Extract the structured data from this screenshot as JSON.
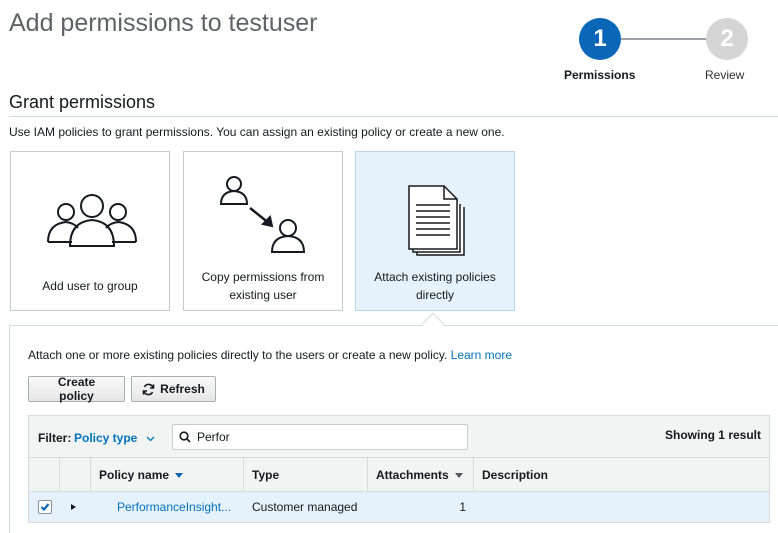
{
  "page": {
    "title": "Add permissions to testuser"
  },
  "stepper": {
    "steps": [
      {
        "number": "1",
        "label": "Permissions"
      },
      {
        "number": "2",
        "label": "Review"
      }
    ]
  },
  "grant": {
    "title": "Grant permissions",
    "description": "Use IAM policies to grant permissions. You can assign an existing policy or create a new one."
  },
  "options": [
    {
      "label": "Add user to group",
      "icon": "group-icon"
    },
    {
      "label_line1": "Copy permissions from",
      "label_line2": "existing user",
      "icon": "copy-user-icon"
    },
    {
      "label_line1": "Attach existing policies",
      "label_line2": "directly",
      "icon": "document-icon",
      "selected": true
    }
  ],
  "attach": {
    "text": "Attach one or more existing policies directly to the users or create a new policy.",
    "learn_more": "Learn more"
  },
  "toolbar": {
    "create_policy_label": "Create policy",
    "refresh_label": "Refresh"
  },
  "filter": {
    "label": "Filter:",
    "select_value": "Policy type",
    "search_value": "Perfor",
    "result_count_text": "Showing 1 result"
  },
  "table": {
    "columns": [
      {
        "label": "Policy name",
        "sortable": true
      },
      {
        "label": "Type"
      },
      {
        "label": "Attachments",
        "sortable": true
      },
      {
        "label": "Description"
      }
    ],
    "rows": [
      {
        "checked": true,
        "policy_name": "PerformanceInsight...",
        "type": "Customer managed",
        "attachments": "1",
        "description": ""
      }
    ]
  },
  "colors": {
    "accent": "#0a66b7",
    "link": "#0073bb",
    "selected_bg": "#e6f2fb"
  }
}
